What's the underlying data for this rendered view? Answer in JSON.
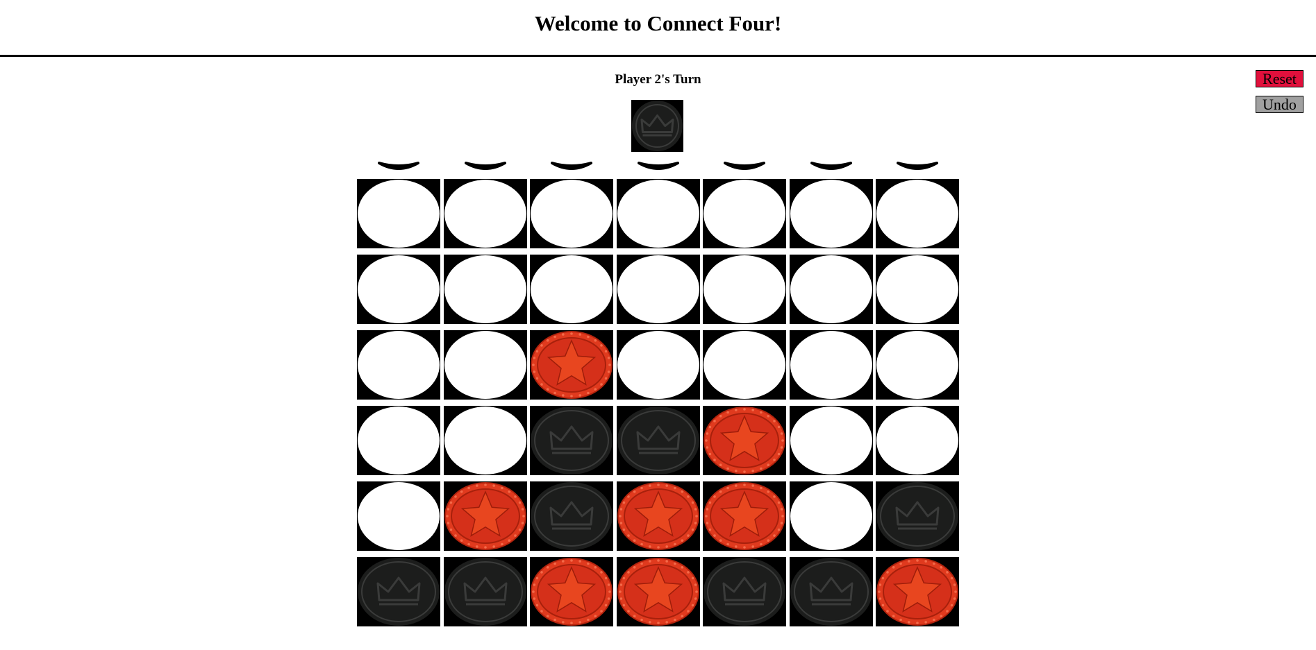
{
  "header": {
    "title": "Welcome to Connect Four!"
  },
  "status": {
    "turn_text": "Player 2's Turn",
    "current_player_piece": "black"
  },
  "controls": {
    "reset_label": "Reset",
    "undo_label": "Undo",
    "reset_color": "#e0103c",
    "undo_color": "#a0a0a0"
  },
  "board": {
    "columns": 7,
    "rows": 6,
    "drop_arrow_icon": "chevron-down-icon",
    "cells": [
      [
        "empty",
        "empty",
        "empty",
        "empty",
        "empty",
        "empty",
        "empty"
      ],
      [
        "empty",
        "empty",
        "empty",
        "empty",
        "empty",
        "empty",
        "empty"
      ],
      [
        "empty",
        "empty",
        "red",
        "empty",
        "empty",
        "empty",
        "empty"
      ],
      [
        "empty",
        "empty",
        "black",
        "black",
        "red",
        "empty",
        "empty"
      ],
      [
        "empty",
        "red",
        "black",
        "red",
        "red",
        "empty",
        "black"
      ],
      [
        "black",
        "black",
        "red",
        "red",
        "black",
        "black",
        "red"
      ]
    ]
  },
  "colors": {
    "cell_background": "#000000",
    "empty_slot": "#ffffff",
    "red_piece": "#e03a1e",
    "red_piece_dark": "#b3230d",
    "black_piece": "#1c1d1c",
    "black_piece_detail": "#3a3b3a"
  }
}
